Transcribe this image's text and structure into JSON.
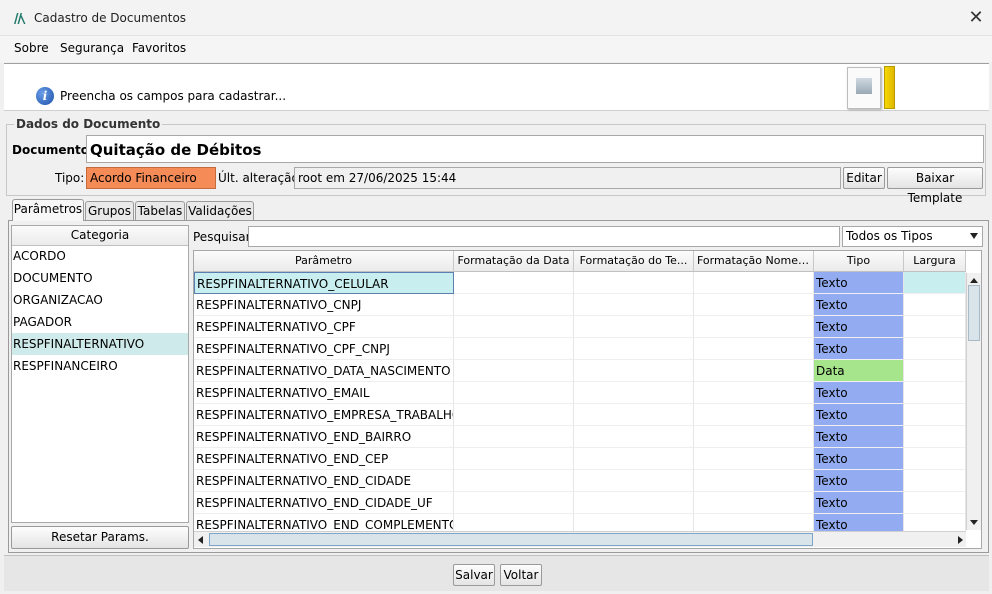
{
  "window": {
    "title": "Cadastro de Documentos",
    "close_glyph": "✕"
  },
  "menu": [
    "Sobre",
    "Segurança",
    "Favoritos"
  ],
  "info": {
    "icon_glyph": "i",
    "message": "Preencha os campos para cadastrar..."
  },
  "dados": {
    "legend": "Dados do Documento",
    "documento_label": "Documento:",
    "documento_value": "Quitação de Débitos",
    "tipo_label": "Tipo:",
    "tipo_value": "Acordo Financeiro",
    "ult_label": "Últ. alteração:",
    "ult_value": "root em 27/06/2025 15:44",
    "editar": "Editar",
    "baixar": "Baixar Template",
    "tipo_color": "#f58b56"
  },
  "tabs": [
    "Parâmetros",
    "Grupos",
    "Tabelas",
    "Validações"
  ],
  "categories": {
    "header": "Categoria",
    "items": [
      "ACORDO",
      "DOCUMENTO",
      "ORGANIZACAO",
      "PAGADOR",
      "RESPFINALTERNATIVO",
      "RESPFINANCEIRO"
    ],
    "selected": "RESPFINALTERNATIVO",
    "reset_button": "Resetar Params."
  },
  "search": {
    "label": "Pesquisar:",
    "value": "",
    "type_filter": "Todos os Tipos"
  },
  "table": {
    "columns": [
      "Parâmetro",
      "Formatação da Data",
      "Formatação do Te...",
      "Formatação Nome ...",
      "Tipo",
      "Largura"
    ],
    "rows": [
      {
        "parametro": "RESPFINALTERNATIVO_CELULAR",
        "tipo": "Texto"
      },
      {
        "parametro": "RESPFINALTERNATIVO_CNPJ",
        "tipo": "Texto"
      },
      {
        "parametro": "RESPFINALTERNATIVO_CPF",
        "tipo": "Texto"
      },
      {
        "parametro": "RESPFINALTERNATIVO_CPF_CNPJ",
        "tipo": "Texto"
      },
      {
        "parametro": "RESPFINALTERNATIVO_DATA_NASCIMENTO",
        "tipo": "Data"
      },
      {
        "parametro": "RESPFINALTERNATIVO_EMAIL",
        "tipo": "Texto"
      },
      {
        "parametro": "RESPFINALTERNATIVO_EMPRESA_TRABALHO",
        "tipo": "Texto"
      },
      {
        "parametro": "RESPFINALTERNATIVO_END_BAIRRO",
        "tipo": "Texto"
      },
      {
        "parametro": "RESPFINALTERNATIVO_END_CEP",
        "tipo": "Texto"
      },
      {
        "parametro": "RESPFINALTERNATIVO_END_CIDADE",
        "tipo": "Texto"
      },
      {
        "parametro": "RESPFINALTERNATIVO_END_CIDADE_UF",
        "tipo": "Texto"
      },
      {
        "parametro": "RESPFINALTERNATIVO_END_COMPLEMENTO",
        "tipo": "Texto"
      }
    ],
    "tipo_colors": {
      "Texto": "#93acf1",
      "Data": "#a6e58c"
    }
  },
  "footer": {
    "salvar": "Salvar",
    "voltar": "Voltar"
  }
}
